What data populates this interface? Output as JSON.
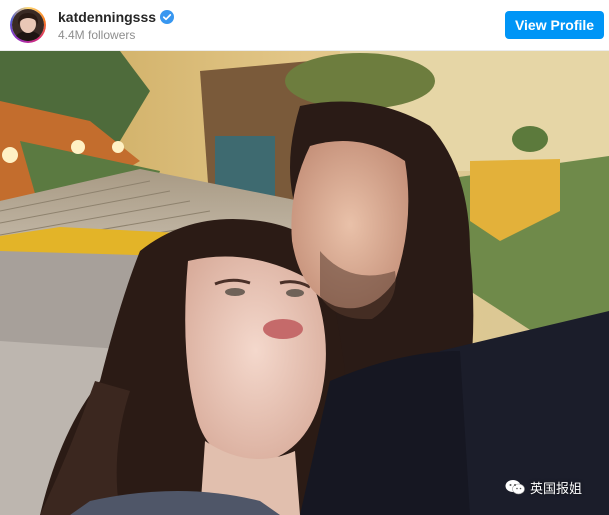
{
  "post_header": {
    "username": "katdenningsss",
    "followers": "4.4M followers",
    "view_profile_label": "View Profile",
    "verified_icon": "verified-badge-icon",
    "accent_color": "#0095f6"
  },
  "photo": {
    "watermark_text": "英国报姐",
    "watermark_icon": "wechat-icon"
  }
}
